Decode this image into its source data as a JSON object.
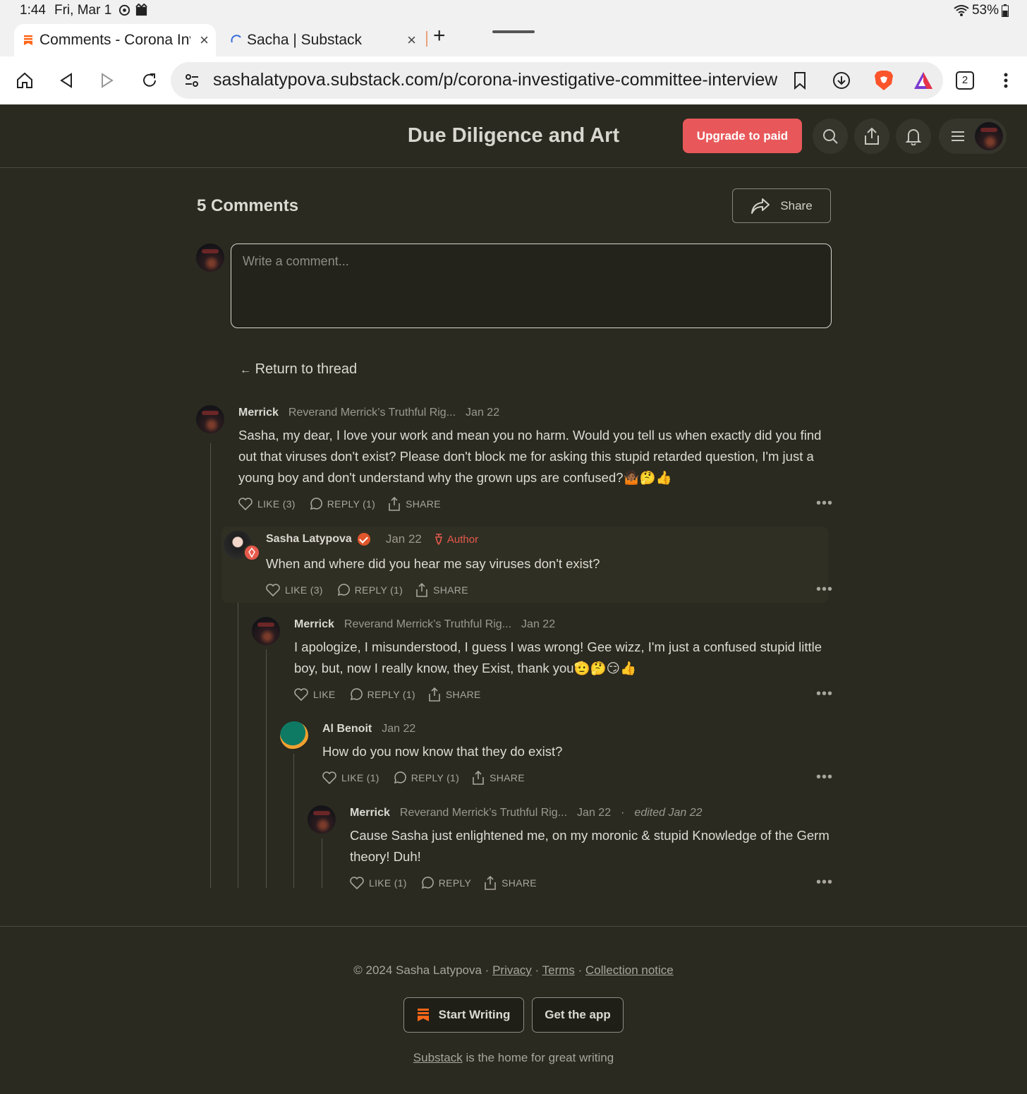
{
  "status_bar": {
    "time": "1:44",
    "date": "Fri, Mar 1",
    "battery": "53%"
  },
  "tabs": [
    {
      "title": "Comments - Corona Investigative Committee",
      "close": "×"
    },
    {
      "title": "Sacha | Substack",
      "close": "×"
    }
  ],
  "new_tab": "+",
  "browser": {
    "url": "sashalatypova.substack.com/p/corona-investigative-committee-interview",
    "tab_count": "2"
  },
  "site": {
    "title": "Due Diligence and Art",
    "upgrade_label": "Upgrade to paid"
  },
  "comments_section": {
    "heading": "5 Comments",
    "share_label": "Share",
    "input_placeholder": "Write a comment...",
    "return_label": "Return to thread"
  },
  "comments": [
    {
      "name": "Merrick",
      "publication": "Reverand Merrick’s Truthful Rig...",
      "date": "Jan 22",
      "text": "Sasha, my dear, I love your work and mean you no harm. Would you tell us when exactly did you find out that viruses don't exist? Please don't block me for asking this stupid retarded question, I'm just a young boy and don't understand why the grown ups are confused?🤷🏾🤔👍",
      "like": "LIKE (3)",
      "reply": "REPLY (1)",
      "share": "SHARE"
    },
    {
      "name": "Sasha Latypova",
      "date": "Jan 22",
      "badge": "Author",
      "text": "When and where did you hear me say viruses don't exist?",
      "like": "LIKE (3)",
      "reply": "REPLY (1)",
      "share": "SHARE"
    },
    {
      "name": "Merrick",
      "publication": "Reverand Merrick’s Truthful Rig...",
      "date": "Jan 22",
      "text": "I apologize, I misunderstood, I guess I was wrong! Gee wizz, I'm just a confused stupid little boy, but, now I really know, they Exist, thank you🫡🤔😏👍",
      "like": "LIKE",
      "reply": "REPLY (1)",
      "share": "SHARE"
    },
    {
      "name": "Al Benoit",
      "date": "Jan 22",
      "text": "How do you now know that they do exist?",
      "like": "LIKE (1)",
      "reply": "REPLY (1)",
      "share": "SHARE"
    },
    {
      "name": "Merrick",
      "publication": "Reverand Merrick’s Truthful Rig...",
      "date": "Jan 22",
      "edited": "edited Jan 22",
      "text": "Cause Sasha just enlightened me, on my moronic & stupid Knowledge of the Germ theory! Duh!",
      "like": "LIKE (1)",
      "reply": "REPLY",
      "share": "SHARE"
    }
  ],
  "more_label": "•••",
  "footer": {
    "copyright": "© 2024 Sasha Latypova",
    "privacy": "Privacy",
    "terms": "Terms",
    "collection": "Collection notice",
    "start_writing": "Start Writing",
    "get_app": "Get the app",
    "substack": "Substack",
    "tagline": " is the home for great writing"
  },
  "colors": {
    "accent": "#e8585a",
    "background": "#2a2a20",
    "substack_orange": "#ff6719",
    "author_red": "#e65a4c"
  }
}
